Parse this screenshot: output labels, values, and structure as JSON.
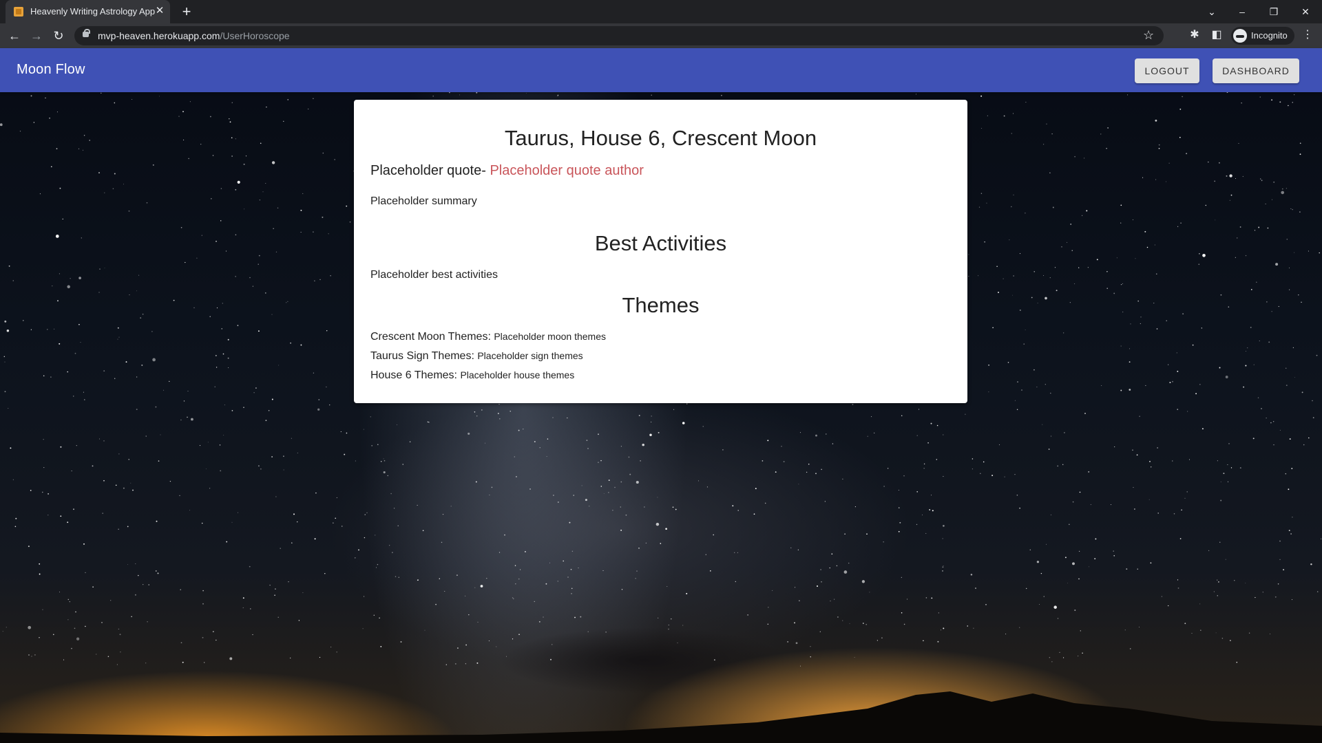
{
  "browser": {
    "tab_title": "Heavenly Writing Astrology App",
    "url_host": "mvp-heaven.herokuapp.com",
    "url_path": "/UserHoroscope",
    "profile_label": "Incognito"
  },
  "app": {
    "title": "Moon Flow",
    "logout_label": "LOGOUT",
    "dashboard_label": "DASHBOARD",
    "accent_color": "#3f51b5"
  },
  "horoscope": {
    "title": "Taurus, House 6, Crescent Moon",
    "quote": "Placeholder quote- ",
    "quote_author": "Placeholder quote author",
    "quote_author_color": "#c9555a",
    "summary": "Placeholder summary",
    "best_activities_heading": "Best Activities",
    "best_activities": "Placeholder best activities",
    "themes_heading": "Themes",
    "themes": [
      {
        "label": "Crescent Moon Themes: ",
        "value": "Placeholder moon themes"
      },
      {
        "label": "Taurus Sign Themes: ",
        "value": "Placeholder sign themes"
      },
      {
        "label": "House 6 Themes: ",
        "value": "Placeholder house themes"
      }
    ]
  }
}
